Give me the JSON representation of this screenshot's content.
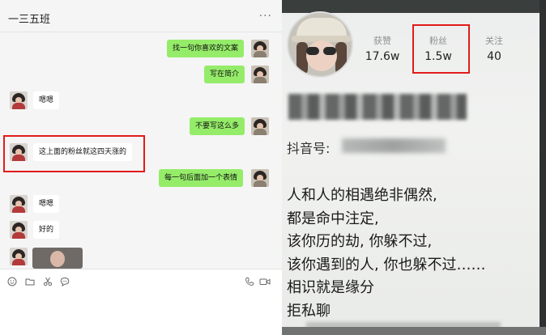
{
  "chat": {
    "title": "一三五班",
    "more_label": "...",
    "messages": [
      {
        "side": "right",
        "text": "找一句你喜欢的文案"
      },
      {
        "side": "right",
        "text": "写在简介"
      },
      {
        "side": "left",
        "text": "嗯嗯"
      },
      {
        "side": "right",
        "text": "不要写这么多"
      },
      {
        "side": "left",
        "text": "这上面的粉丝就这四天涨的"
      },
      {
        "side": "right",
        "text": "每一句后面加一个表情"
      },
      {
        "side": "left",
        "text": "嗯嗯"
      },
      {
        "side": "left",
        "text": "好的"
      }
    ],
    "toolbar": {
      "emoji_icon": "emoji-icon",
      "folder_icon": "folder-icon",
      "scissors_icon": "scissors-icon",
      "chat_icon": "chat-bubble-icon",
      "phone_icon": "phone-icon",
      "video_icon": "video-icon"
    }
  },
  "profile": {
    "stats": [
      {
        "label": "获赞",
        "value": "17.6w"
      },
      {
        "label": "粉丝",
        "value": "1.5w"
      },
      {
        "label": "关注",
        "value": "40"
      }
    ],
    "id_label": "抖音号:",
    "bio": [
      "人和人的相遇绝非偶然,",
      "都是命中注定,",
      "该你历的劫, 你躲不过,",
      "该你遇到的人, 你也躲不过……",
      "相识就是缘分",
      "拒私聊"
    ]
  },
  "colors": {
    "highlight": "#e21b1b",
    "bubble_green": "#95ec69",
    "bubble_white": "#ffffff"
  }
}
